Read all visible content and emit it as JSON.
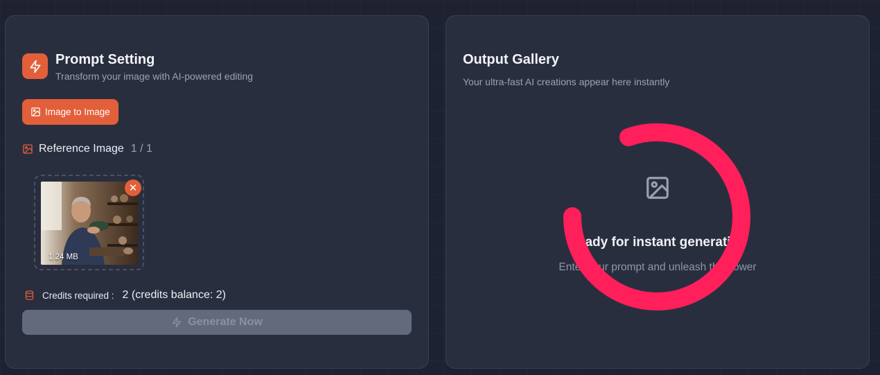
{
  "prompt_panel": {
    "title": "Prompt Setting",
    "subtitle": "Transform your image with AI-powered editing",
    "header_icon": "lightning-icon",
    "mode_button": {
      "label": "Image to Image",
      "icon": "image-icon"
    },
    "reference": {
      "label": "Reference Image",
      "count": "1 / 1",
      "icon": "image-icon",
      "thumbnail": {
        "size": "1.24 MB",
        "remove_icon": "close-icon"
      }
    },
    "credits": {
      "label": "Credits required :",
      "value": "2 (credits balance: 2)",
      "icon": "database-icon"
    },
    "generate_button": {
      "label": "Generate Now",
      "icon": "lightning-icon",
      "disabled": true
    }
  },
  "output_panel": {
    "title": "Output Gallery",
    "subtitle": "Your ultra-fast AI creations appear here instantly",
    "empty_state": {
      "icon": "image-placeholder-icon",
      "title": "Ready for instant generation",
      "subtitle": "Enter your prompt and unleash the power"
    }
  },
  "colors": {
    "accent": "#e35f3a",
    "spinner": "#ff1f5a",
    "panel_bg": "#292e3f",
    "page_bg": "#1d2130",
    "disabled_button": "#636a7c"
  }
}
